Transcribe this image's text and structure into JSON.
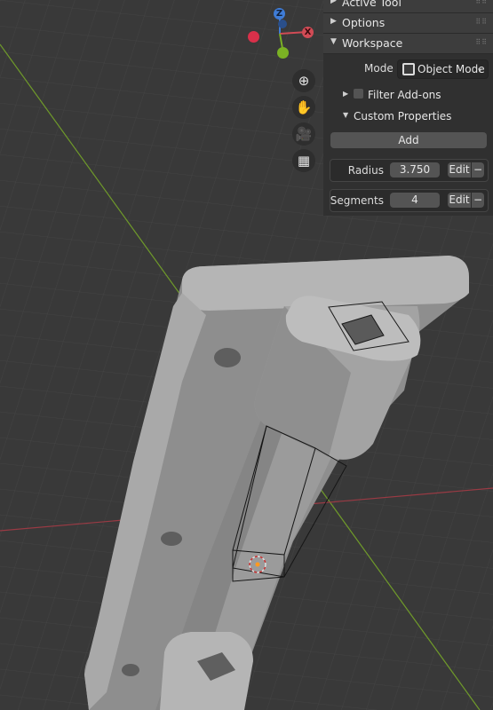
{
  "viewport": {
    "gizmo": {
      "z_label": "Z",
      "x_label": "X"
    },
    "nav_buttons": [
      {
        "name": "zoom-icon",
        "glyph": "⊕"
      },
      {
        "name": "hand-pan-icon",
        "glyph": "✋"
      },
      {
        "name": "camera-icon",
        "glyph": "🎥"
      },
      {
        "name": "perspective-grid-icon",
        "glyph": "▦"
      }
    ],
    "colors": {
      "x_axis": "#d14b55",
      "y_axis": "#7bb224",
      "z_axis": "#3f7cd6",
      "grid_bg": "#3a3a3a"
    }
  },
  "sidebar": {
    "sections": {
      "active_tool": "Active Tool",
      "options": "Options",
      "workspace": "Workspace"
    },
    "mode": {
      "label": "Mode",
      "value": "Object Mode"
    },
    "filter_addons": {
      "label": "Filter Add-ons",
      "checked": false
    },
    "custom_properties": {
      "label": "Custom Properties"
    },
    "add_label": "Add",
    "properties": [
      {
        "name": "Radius",
        "value": "3.750",
        "edit": "Edit",
        "remove": "−"
      },
      {
        "name": "Segments",
        "value": "4",
        "edit": "Edit",
        "remove": "−"
      }
    ]
  }
}
